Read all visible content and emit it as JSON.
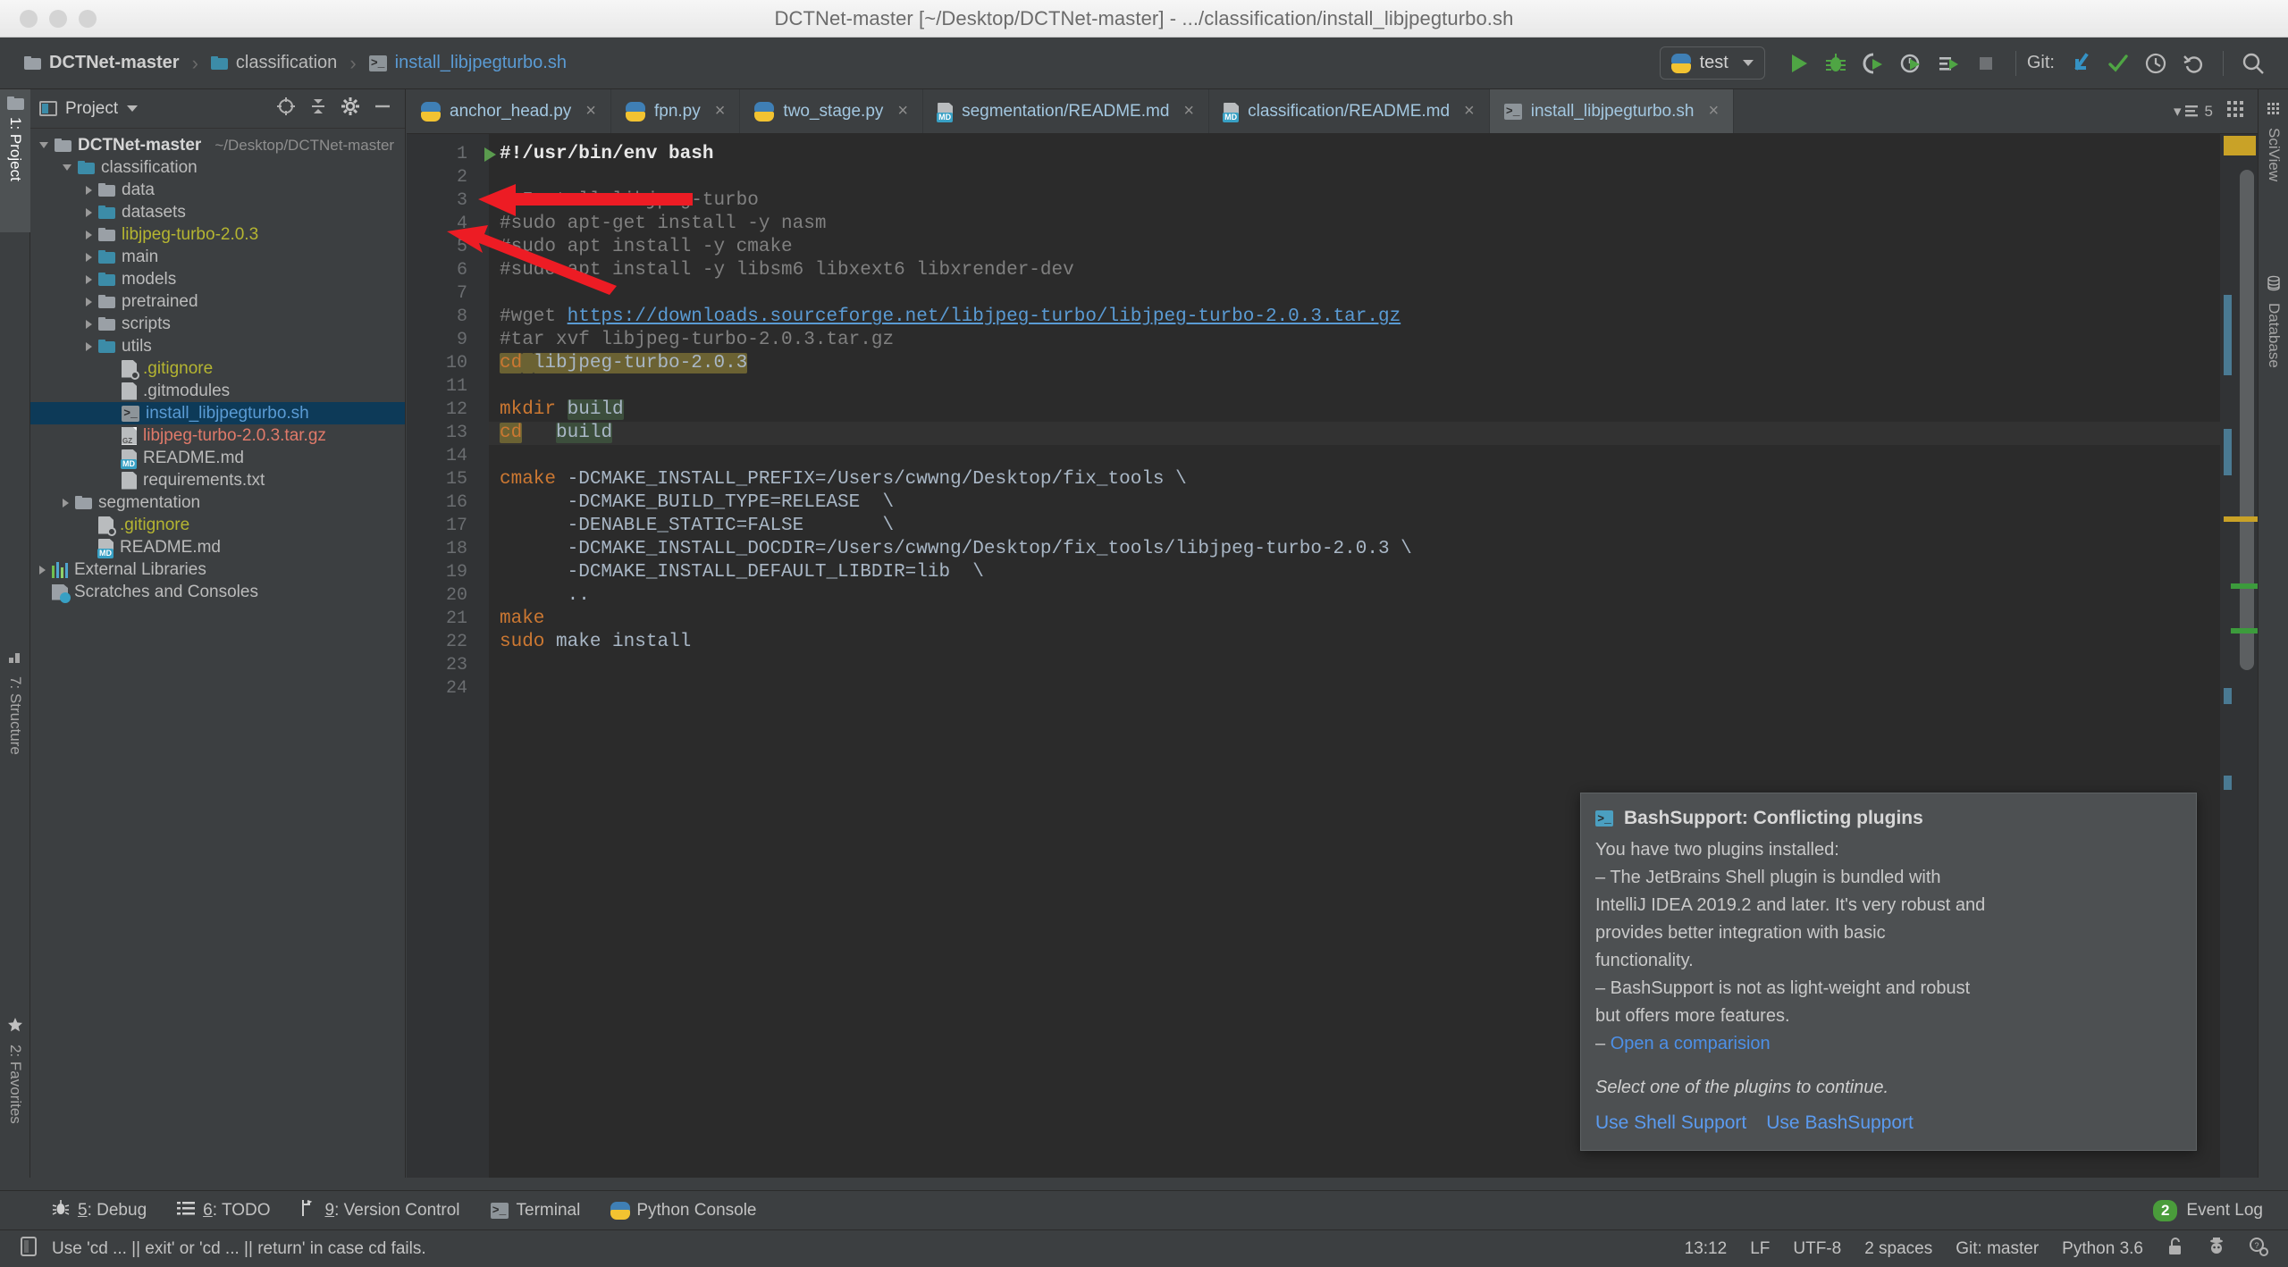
{
  "window": {
    "title": "DCTNet-master [~/Desktop/DCTNet-master] - .../classification/install_libjpegturbo.sh",
    "traffic_lights": [
      "close-button",
      "minimize-button",
      "maximize-button"
    ]
  },
  "breadcrumb": {
    "items": [
      {
        "label": "DCTNet-master",
        "icon": "folder-icon",
        "style": "bold"
      },
      {
        "label": "classification",
        "icon": "folder-teal-icon",
        "style": "normal"
      },
      {
        "label": "install_libjpegturbo.sh",
        "icon": "shell-script-icon",
        "style": "file"
      }
    ],
    "separator": "›"
  },
  "toolbar": {
    "run_config": {
      "label": "test",
      "icon": "python-logo-icon",
      "dropdown": "▾"
    },
    "buttons": [
      {
        "name": "run-button",
        "glyph": "▶",
        "color": "#4fa544"
      },
      {
        "name": "debug-button",
        "glyph": "bug",
        "color": "#4fa544"
      },
      {
        "name": "run-with-coverage-button",
        "glyph": "coverage",
        "color": "#4fa544"
      },
      {
        "name": "profile-button",
        "glyph": "profile",
        "color": "#4fa544"
      },
      {
        "name": "run-with-console-button",
        "glyph": "console",
        "color": "#4fa544"
      },
      {
        "name": "stop-button",
        "glyph": "■",
        "color": "#6e7174"
      }
    ],
    "git_label": "Git:",
    "git_buttons": [
      {
        "name": "update-project-button",
        "glyph": "↙",
        "color": "#3592c4"
      },
      {
        "name": "commit-button",
        "glyph": "✓",
        "color": "#4fa544"
      },
      {
        "name": "history-button",
        "glyph": "clock",
        "color": "#b8b8b8"
      },
      {
        "name": "rollback-button",
        "glyph": "↶",
        "color": "#b8b8b8"
      }
    ],
    "search_button": {
      "name": "search-everywhere-button",
      "glyph": "⌕"
    }
  },
  "left_strip": {
    "tabs": [
      {
        "label": "1: Project",
        "active": true,
        "icon": "project-folder-icon"
      },
      {
        "label": "7: Structure",
        "active": false,
        "icon": "structure-icon"
      },
      {
        "label": "2: Favorites",
        "active": false,
        "icon": "star-icon"
      }
    ]
  },
  "right_strip": {
    "tabs": [
      {
        "label": "SciView",
        "icon": "grid-icon"
      },
      {
        "label": "Database",
        "icon": "database-icon"
      }
    ]
  },
  "project_panel": {
    "header": {
      "title": "Project",
      "dropdown": "▾",
      "icons": [
        "locate-icon",
        "collapse-all-icon",
        "settings-gear-icon",
        "hide-icon"
      ]
    },
    "tree": [
      {
        "depth": 0,
        "twisty": "open",
        "icon": "folder-icon",
        "label": "DCTNet-master",
        "path": "~/Desktop/DCTNet-master",
        "style": "bold"
      },
      {
        "depth": 1,
        "twisty": "open",
        "icon": "folder-teal-icon",
        "label": "classification",
        "style": "normal"
      },
      {
        "depth": 2,
        "twisty": "closed",
        "icon": "folder-icon",
        "label": "data",
        "style": "normal"
      },
      {
        "depth": 2,
        "twisty": "closed",
        "icon": "folder-teal-icon",
        "label": "datasets",
        "style": "normal"
      },
      {
        "depth": 2,
        "twisty": "closed",
        "icon": "folder-icon",
        "label": "libjpeg-turbo-2.0.3",
        "style": "yellow"
      },
      {
        "depth": 2,
        "twisty": "closed",
        "icon": "folder-teal-icon",
        "label": "main",
        "style": "normal"
      },
      {
        "depth": 2,
        "twisty": "closed",
        "icon": "folder-teal-icon",
        "label": "models",
        "style": "normal"
      },
      {
        "depth": 2,
        "twisty": "closed",
        "icon": "folder-icon",
        "label": "pretrained",
        "style": "normal"
      },
      {
        "depth": 2,
        "twisty": "closed",
        "icon": "folder-icon",
        "label": "scripts",
        "style": "normal"
      },
      {
        "depth": 2,
        "twisty": "closed",
        "icon": "folder-teal-icon",
        "label": "utils",
        "style": "normal"
      },
      {
        "depth": 3,
        "twisty": "none",
        "icon": "gitignore-file-icon",
        "label": ".gitignore",
        "style": "yellow"
      },
      {
        "depth": 3,
        "twisty": "none",
        "icon": "text-file-icon",
        "label": ".gitmodules",
        "style": "normal"
      },
      {
        "depth": 3,
        "twisty": "none",
        "icon": "shell-script-icon",
        "label": "install_libjpegturbo.sh",
        "style": "blue",
        "selected": true
      },
      {
        "depth": 3,
        "twisty": "none",
        "icon": "archive-file-icon",
        "label": "libjpeg-turbo-2.0.3.tar.gz",
        "style": "red"
      },
      {
        "depth": 3,
        "twisty": "none",
        "icon": "markdown-file-icon",
        "label": "README.md",
        "style": "normal"
      },
      {
        "depth": 3,
        "twisty": "none",
        "icon": "text-file-icon",
        "label": "requirements.txt",
        "style": "normal"
      },
      {
        "depth": 1,
        "twisty": "closed",
        "icon": "folder-icon",
        "label": "segmentation",
        "style": "normal"
      },
      {
        "depth": 2,
        "twisty": "none",
        "icon": "gitignore-file-icon",
        "label": ".gitignore",
        "style": "yellow"
      },
      {
        "depth": 2,
        "twisty": "none",
        "icon": "markdown-file-icon",
        "label": "README.md",
        "style": "normal"
      },
      {
        "depth": 0,
        "twisty": "closed",
        "icon": "external-libraries-icon",
        "label": "External Libraries",
        "style": "normal"
      },
      {
        "depth": 0,
        "twisty": "none",
        "icon": "scratches-icon",
        "label": "Scratches and Consoles",
        "style": "normal"
      }
    ]
  },
  "editor": {
    "tabs": [
      {
        "label": "anchor_head.py",
        "icon": "python-file-icon",
        "active": false,
        "close": "×"
      },
      {
        "label": "fpn.py",
        "icon": "python-file-icon",
        "active": false,
        "close": "×"
      },
      {
        "label": "two_stage.py",
        "icon": "python-file-icon",
        "active": false,
        "close": "×"
      },
      {
        "label": "segmentation/README.md",
        "icon": "markdown-file-icon",
        "active": false,
        "close": "×"
      },
      {
        "label": "classification/README.md",
        "icon": "markdown-file-icon",
        "active": false,
        "close": "×"
      },
      {
        "label": "install_libjpegturbo.sh",
        "icon": "shell-script-icon",
        "active": true,
        "close": "×"
      }
    ],
    "tab_overflow_count": "5",
    "lines": [
      {
        "n": "1",
        "runnable": true,
        "tokens": [
          {
            "t": "#!/usr/bin/env bash",
            "c": "plain-bold"
          }
        ]
      },
      {
        "n": "2",
        "tokens": []
      },
      {
        "n": "3",
        "tokens": [
          {
            "t": "# Install libjpeg-turbo",
            "c": "cmt"
          }
        ]
      },
      {
        "n": "4",
        "changed": true,
        "tokens": [
          {
            "t": "#sudo apt-get install -y nasm",
            "c": "cmt"
          }
        ]
      },
      {
        "n": "5",
        "changed": true,
        "tokens": [
          {
            "t": "#sudo apt install -y cmake",
            "c": "cmt"
          }
        ]
      },
      {
        "n": "6",
        "changed": true,
        "tokens": [
          {
            "t": "#sudo apt install -y libsm6 libxext6 libxrender-dev",
            "c": "cmt"
          }
        ]
      },
      {
        "n": "7",
        "tokens": []
      },
      {
        "n": "8",
        "changed": true,
        "tokens": [
          {
            "t": "#wget ",
            "c": "cmt"
          },
          {
            "t": "https://downloads.sourceforge.net/libjpeg-turbo/libjpeg-turbo-2.0.3.tar.gz",
            "c": "link"
          }
        ]
      },
      {
        "n": "9",
        "changed": true,
        "tokens": [
          {
            "t": "#tar xvf libjpeg-turbo-2.0.3.tar.gz",
            "c": "cmt"
          }
        ]
      },
      {
        "n": "10",
        "tokens": [
          {
            "t": "cd",
            "c": "kw hl-a"
          },
          {
            "t": " ",
            "c": "hl-a"
          },
          {
            "t": "libjpeg-turbo-2.0.3",
            "c": "plain hl-a"
          }
        ]
      },
      {
        "n": "11",
        "tokens": []
      },
      {
        "n": "12",
        "bulb": true,
        "tokens": [
          {
            "t": "mkdir",
            "c": "kw"
          },
          {
            "t": " ",
            "c": "plain"
          },
          {
            "t": "build",
            "c": "plain hl-b"
          }
        ]
      },
      {
        "n": "13",
        "current": true,
        "tokens": [
          {
            "t": "cd",
            "c": "kw hl-a"
          },
          {
            "t": "   ",
            "c": "plain"
          },
          {
            "t": "build",
            "c": "plain hl-b"
          }
        ]
      },
      {
        "n": "14",
        "tokens": []
      },
      {
        "n": "15",
        "changed": true,
        "tokens": [
          {
            "t": "cmake",
            "c": "kw"
          },
          {
            "t": " -DCMAKE_INSTALL_PREFIX=/Users/cwwng/Desktop/fix_tools \\",
            "c": "plain"
          }
        ]
      },
      {
        "n": "16",
        "tokens": [
          {
            "t": "      -DCMAKE_BUILD_TYPE=RELEASE  \\",
            "c": "plain"
          }
        ]
      },
      {
        "n": "17",
        "tokens": [
          {
            "t": "      -DENABLE_STATIC=FALSE       \\",
            "c": "plain"
          }
        ]
      },
      {
        "n": "18",
        "changed": true,
        "tokens": [
          {
            "t": "      -DCMAKE_INSTALL_DOCDIR=/Users/cwwng/Desktop/fix_tools/libjpeg-turbo-2.0.3 \\",
            "c": "plain"
          }
        ]
      },
      {
        "n": "19",
        "tokens": [
          {
            "t": "      -DCMAKE_INSTALL_DEFAULT_LIBDIR=lib  \\",
            "c": "plain"
          }
        ]
      },
      {
        "n": "20",
        "tokens": [
          {
            "t": "      ..",
            "c": "plain"
          }
        ]
      },
      {
        "n": "21",
        "tokens": [
          {
            "t": "make",
            "c": "kw"
          }
        ]
      },
      {
        "n": "22",
        "tokens": [
          {
            "t": "sudo",
            "c": "kw"
          },
          {
            "t": " make install",
            "c": "plain"
          }
        ]
      },
      {
        "n": "23",
        "tokens": []
      },
      {
        "n": "24",
        "tokens": []
      }
    ],
    "annotations": [
      {
        "name": "red-arrow-nasm",
        "points_to": "line 4 (#sudo apt-get install -y nasm)",
        "color": "#ed1c24"
      },
      {
        "name": "red-arrow-cmake",
        "points_to": "line 5 (#sudo apt install -y cmake)",
        "color": "#ed1c24"
      }
    ]
  },
  "notification": {
    "icon": "shell-script-icon",
    "title": "BashSupport: Conflicting plugins",
    "lines": [
      "You have two plugins installed:",
      "– The JetBrains Shell plugin is bundled with",
      "IntelliJ IDEA 2019.2 and later. It's very robust and",
      "provides better integration with basic",
      "functionality.",
      "– BashSupport is not as light-weight and robust",
      "but offers more features."
    ],
    "link_prefix": "– ",
    "link_label": "Open a comparision",
    "footer_italic": "Select one of the plugins to continue.",
    "actions": [
      "Use Shell Support",
      "Use BashSupport"
    ]
  },
  "tool_window_bar": {
    "buttons": [
      {
        "num": "5",
        "label": "Debug",
        "icon": "bug-icon"
      },
      {
        "num": "6",
        "label": "TODO",
        "icon": "list-icon"
      },
      {
        "num": "9",
        "label": "Version Control",
        "icon": "branch-icon"
      },
      {
        "num": "",
        "label": "Terminal",
        "icon": "terminal-icon"
      },
      {
        "num": "",
        "label": "Python Console",
        "icon": "python-logo-icon"
      }
    ],
    "event_log": {
      "count": "2",
      "label": "Event Log"
    }
  },
  "status_bar": {
    "icon": "document-icon",
    "message": "Use 'cd ... || exit' or 'cd ... || return' in case cd fails.",
    "right_items": [
      {
        "name": "caret-position",
        "label": "13:12"
      },
      {
        "name": "line-separator",
        "label": "LF"
      },
      {
        "name": "file-encoding",
        "label": "UTF-8"
      },
      {
        "name": "indent-setting",
        "label": "2 spaces"
      },
      {
        "name": "git-branch",
        "label": "Git: master"
      },
      {
        "name": "python-interpreter",
        "label": "Python 3.6"
      }
    ],
    "right_icons": [
      "unlock-icon",
      "inspector-icon",
      "event-settings-icon"
    ]
  },
  "colors": {
    "accent_blue": "#5a9bd4",
    "keyword_orange": "#cc7832",
    "comment_gray": "#808080",
    "selection_blue": "#0d3a58",
    "arrow_red": "#ed1c24",
    "green": "#4fa544",
    "editor_bg": "#2b2b2b",
    "chrome_bg": "#3c3f41"
  }
}
